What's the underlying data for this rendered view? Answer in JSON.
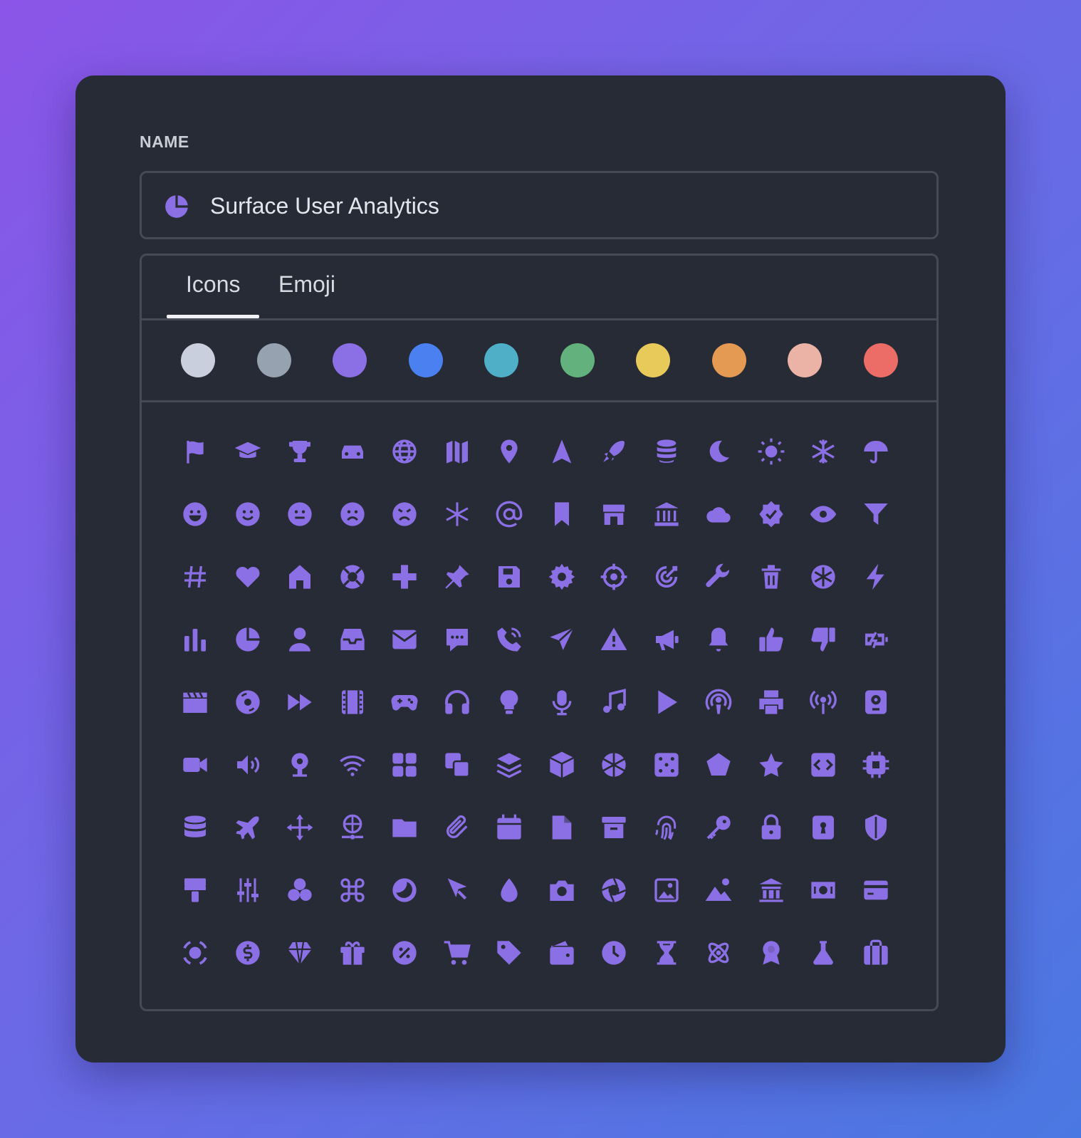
{
  "name_label": "NAME",
  "name_field": {
    "value": "Surface User Analytics",
    "icon": "pie-chart-icon"
  },
  "tabs": [
    {
      "label": "Icons",
      "active": true
    },
    {
      "label": "Emoji",
      "active": false
    }
  ],
  "accent_color": "#8b6fe4",
  "swatches": [
    "#c9cfdc",
    "#97a2b1",
    "#8b6fe4",
    "#4b80f0",
    "#4eafc6",
    "#63b27e",
    "#e8ca5a",
    "#e49a52",
    "#eab3a6",
    "#ec6c67"
  ],
  "icons": [
    [
      "flag",
      "graduation-cap",
      "trophy",
      "car",
      "globe",
      "map",
      "map-pin",
      "navigation-arrow",
      "rocket",
      "coins-stack",
      "moon",
      "sun",
      "snowflake",
      "umbrella"
    ],
    [
      "grin-face",
      "smile-face",
      "neutral-face",
      "sad-face",
      "angry-face",
      "asterisk",
      "at-sign",
      "bookmark",
      "store",
      "bank",
      "cloud",
      "verified-badge",
      "eye",
      "filter"
    ],
    [
      "hash",
      "heart",
      "home",
      "lifebuoy",
      "plus",
      "pin",
      "floppy-disk",
      "gear",
      "crosshair",
      "target",
      "wrench",
      "trash",
      "snowflake-circle",
      "lightning"
    ],
    [
      "bar-chart",
      "pie-chart",
      "user",
      "inbox",
      "envelope",
      "chat-bubble",
      "phone",
      "paper-plane",
      "warning",
      "megaphone",
      "bell",
      "thumbs-up",
      "thumbs-down",
      "battery-charging"
    ],
    [
      "clapperboard",
      "vinyl-disc",
      "fast-forward",
      "film",
      "gamepad",
      "headphones",
      "lightbulb",
      "microphone",
      "music-note",
      "play",
      "podcast",
      "printer",
      "broadcast",
      "speaker"
    ],
    [
      "video-camera",
      "volume",
      "webcam",
      "wifi",
      "grid-apps",
      "copy",
      "layers",
      "cube",
      "snowflake-hex",
      "dice",
      "pentagon",
      "star",
      "code",
      "cpu"
    ],
    [
      "database",
      "airplane",
      "move-arrows",
      "globe-network",
      "folder",
      "paperclip",
      "calendar",
      "file",
      "archive",
      "fingerprint",
      "key",
      "lock",
      "keyhole",
      "shield"
    ],
    [
      "paint-roller",
      "sliders",
      "color-circles",
      "command",
      "moon-circle",
      "cursor",
      "droplet",
      "camera",
      "aperture",
      "image",
      "landscape",
      "museum",
      "money-bill",
      "credit-card"
    ],
    [
      "focus-circle",
      "dollar-coin",
      "diamond",
      "gift",
      "percent",
      "shopping-cart",
      "tag",
      "wallet",
      "clock",
      "hourglass",
      "atom",
      "award",
      "flask",
      "briefcase"
    ]
  ]
}
